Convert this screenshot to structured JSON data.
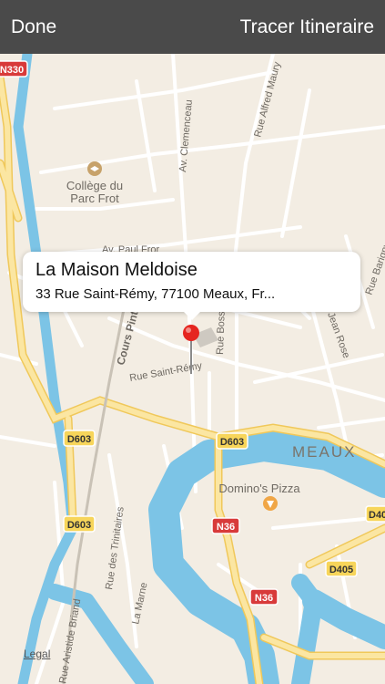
{
  "toolbar": {
    "done_label": "Done",
    "route_label": "Tracer Itineraire"
  },
  "callout": {
    "title": "La Maison Meldoise",
    "address": "33 Rue Saint-Rémy, 77100 Meaux, Fr..."
  },
  "map": {
    "street_labels": {
      "av_clemenceau": "Av. Clemenceau",
      "rue_alfred_maury": "Rue Alfred Maury",
      "av_paul_fror": "Av. Paul Fror",
      "cours_pinteville": "Cours Pinte",
      "rue_bossuet": "Rue Boss",
      "rue_saint_remy": "Rue Saint-Rémy",
      "rue_jean_rose": "Jean Rose",
      "rue_barigny": "Rue Barigny",
      "rue_des_trinitaires": "Rue des Trinitaires",
      "la_marne": "La Marne",
      "rue_aristide_briand": "Rue Aristide Briand"
    },
    "poi": {
      "college": "Collège du Parc Frot",
      "pizza": "Domino's Pizza"
    },
    "city_label": "MEAUX",
    "road_shields": {
      "n330": "N330",
      "d603_left": "D603",
      "d603_mid": "D603",
      "d603_bottom": "D603",
      "n36_top": "N36",
      "n36_bottom": "N36",
      "d405": "D405",
      "d40_right": "D40"
    },
    "colors": {
      "land": "#f3ede3",
      "water": "#7cc4e6",
      "major_road": "#fbe6a2",
      "minor_road": "#ffffff",
      "shield_red": "#d83a3a",
      "shield_yellow": "#f7d55a",
      "pin": "#e5251f"
    }
  },
  "legal_label": "Legal"
}
